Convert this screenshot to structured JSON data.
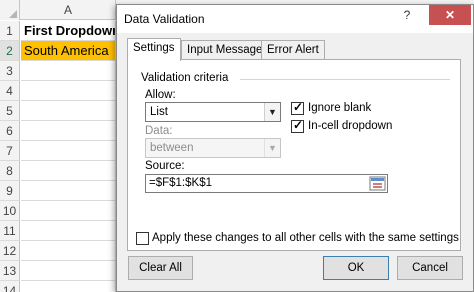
{
  "sheet": {
    "columns": [
      "A"
    ],
    "rows": [
      "1",
      "2",
      "3",
      "4",
      "5",
      "6",
      "7",
      "8",
      "9",
      "10",
      "11",
      "12",
      "13",
      "14"
    ],
    "a1": "First Dropdown",
    "a2": "South America"
  },
  "dialog": {
    "title": "Data Validation",
    "help_glyph": "?",
    "close_glyph": "✕",
    "tabs": [
      {
        "label": "Settings",
        "active": true
      },
      {
        "label": "Input Message",
        "active": false
      },
      {
        "label": "Error Alert",
        "active": false
      }
    ],
    "group_label": "Validation criteria",
    "allow_label": "Allow:",
    "allow_value": "List",
    "ignore_blank_label": "Ignore blank",
    "ignore_blank_checked": true,
    "in_cell_dropdown_label": "In-cell dropdown",
    "in_cell_dropdown_checked": true,
    "data_label": "Data:",
    "data_value": "between",
    "source_label": "Source:",
    "source_value": "=$F$1:$K$1",
    "apply_label": "Apply these changes to all other cells with the same settings",
    "apply_checked": false,
    "clear_all": "Clear All",
    "ok": "OK",
    "cancel": "Cancel"
  },
  "colors": {
    "cell_fill": "#ffc000",
    "close_button": "#c75050",
    "default_button_border": "#3c7fb1"
  },
  "icons": [
    "dropdown-arrow-icon",
    "range-selector-icon",
    "checkmark-icon"
  ]
}
